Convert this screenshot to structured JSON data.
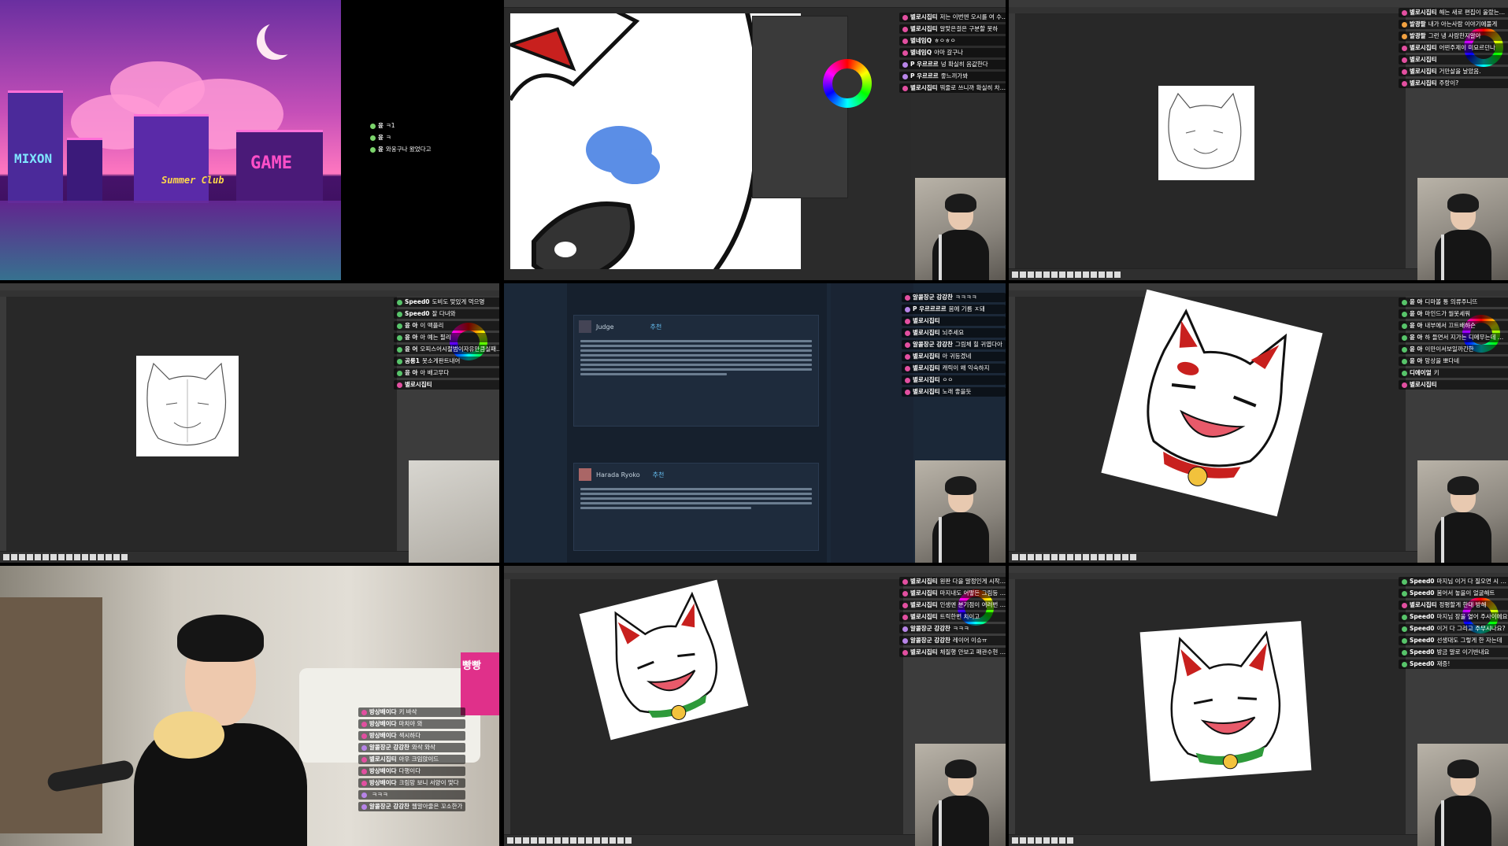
{
  "cells": {
    "c1": {
      "signs": {
        "left": "MIXON",
        "center": "Summer Club",
        "right": "GAME"
      },
      "chat": [
        {
          "nick": "윤",
          "text": "ㅋ1",
          "color": "#7bd36b"
        },
        {
          "nick": "윤",
          "text": "ㅋ",
          "color": "#7bd36b"
        },
        {
          "nick": "윤",
          "text": "와웅구나 왔었다고",
          "color": "#7bd36b"
        }
      ]
    },
    "c2": {
      "chat": [
        {
          "nick": "별로시집티",
          "text": "저는 이번엔 오시를 여 수업에 대해서 알게됐는데",
          "color": "#e24fa0"
        },
        {
          "nick": "별로시집티",
          "text": "알맞은걸은 구분할 못하",
          "color": "#e24fa0"
        },
        {
          "nick": "별네임Q",
          "text": "ㅎㅇㅎㅇ",
          "color": "#e24fa0"
        },
        {
          "nick": "별네임Q",
          "text": "아마 갈구나",
          "color": "#e24fa0"
        },
        {
          "nick": "P 우르르르",
          "text": "넝 확실히 음값한다",
          "color": "#b784e8"
        },
        {
          "nick": "P 우르르르",
          "text": "좋느끼가봐",
          "color": "#b784e8"
        },
        {
          "nick": "별로시집티",
          "text": "뭐줄로 쓰니까 확실히 차이를 느끼겠음",
          "color": "#e24fa0"
        }
      ]
    },
    "c3": {
      "chat": [
        {
          "nick": "별로시집티",
          "text": "해는 새로 편집이 울랐는데, 기존 우로겠다",
          "color": "#e24fa0"
        },
        {
          "nick": "발광팔",
          "text": "내가 아는사람 이야기에풀게",
          "color": "#f0a040"
        },
        {
          "nick": "발광팔",
          "text": "그런 냉 사람한지알아",
          "color": "#f0a040"
        },
        {
          "nick": "별로시집티",
          "text": "어떤주제이 미묘르던나",
          "color": "#e24fa0"
        },
        {
          "nick": "별로시집티",
          "text": "",
          "color": "#e24fa0"
        },
        {
          "nick": "별로시집티",
          "text": "거만살을 날았음.",
          "color": "#e24fa0"
        },
        {
          "nick": "별로시집티",
          "text": "주랑이?",
          "color": "#e24fa0"
        }
      ]
    },
    "c4": {
      "chat": [
        {
          "nick": "Speed0",
          "text": "도비도 맞있게 먹으명",
          "color": "#57c46a"
        },
        {
          "nick": "Speed0",
          "text": "잘 다녀와",
          "color": "#57c46a"
        },
        {
          "nick": "윤 아",
          "text": "이 맥플리",
          "color": "#57c46a"
        },
        {
          "nick": "윤 아",
          "text": "아 예는 필리",
          "color": "#57c46a"
        },
        {
          "nick": "윤 어",
          "text": "오피스어시절범이자유만큼실패뛰어요",
          "color": "#57c46a"
        },
        {
          "nick": "공룡1",
          "text": "못소게판트내어",
          "color": "#57c46a"
        },
        {
          "nick": "윤 아",
          "text": "아 배고무다",
          "color": "#57c46a"
        },
        {
          "nick": "별로시집티",
          "text": "",
          "color": "#e24fa0"
        }
      ]
    },
    "c5": {
      "reviews": [
        {
          "author": "Judge",
          "verdict": "추천"
        },
        {
          "author": "Harada Ryoko",
          "verdict": "추천"
        }
      ],
      "chat": [
        {
          "nick": "알콜장군 강강찬",
          "text": "ㅋㅋㅋㅋ",
          "color": "#e24fa0"
        },
        {
          "nick": "P 우르르르르",
          "text": "몸에 기름 ㅈ돼",
          "color": "#b784e8"
        },
        {
          "nick": "별로시집티",
          "text": "",
          "color": "#e24fa0"
        },
        {
          "nick": "별로시집티",
          "text": "뇌주세요",
          "color": "#e24fa0"
        },
        {
          "nick": "알콜장군 강강찬",
          "text": "그림체 힐 귀엽다아",
          "color": "#e24fa0"
        },
        {
          "nick": "별로시집티",
          "text": "아 귀등겠네",
          "color": "#e24fa0"
        },
        {
          "nick": "별로시집티",
          "text": "캐릭이 왜 익숙하지",
          "color": "#e24fa0"
        },
        {
          "nick": "별로시집티",
          "text": "ㅇㅇ",
          "color": "#e24fa0"
        },
        {
          "nick": "별로시집티",
          "text": "노래 좋을듯",
          "color": "#e24fa0"
        }
      ]
    },
    "c6": {
      "chat": [
        {
          "nick": "윤 아",
          "text": "디마볼 통 의류주니뜨",
          "color": "#57c46a"
        },
        {
          "nick": "윤 아",
          "text": "마인드가 월못세워",
          "color": "#57c46a"
        },
        {
          "nick": "윤 아",
          "text": "내부에서 끄트배하슨",
          "color": "#57c46a"
        },
        {
          "nick": "윤 아",
          "text": "하 들면서 지가는 디메무는데 뭐 문이었던데",
          "color": "#57c46a"
        },
        {
          "nick": "윤 아",
          "text": "이만이서보일까긴한",
          "color": "#57c46a"
        },
        {
          "nick": "윤 아",
          "text": "망상을 뽀다네",
          "color": "#57c46a"
        },
        {
          "nick": "디에이얼",
          "text": "키",
          "color": "#57c46a"
        },
        {
          "nick": "별로시집티",
          "text": "",
          "color": "#e24fa0"
        }
      ]
    },
    "c7": {
      "chat": [
        {
          "nick": "방상배이다",
          "text": "키 바삭",
          "color": "#e24fa0"
        },
        {
          "nick": "방상배이다",
          "text": "마치야 와",
          "color": "#e24fa0"
        },
        {
          "nick": "방상배이다",
          "text": "섹시하다",
          "color": "#e24fa0"
        },
        {
          "nick": "알콜장군 강강찬",
          "text": "와삭 와삭",
          "color": "#b784e8"
        },
        {
          "nick": "별로시집티",
          "text": "아우 크임앉이드",
          "color": "#e24fa0"
        },
        {
          "nick": "방상배이다",
          "text": "다행이다",
          "color": "#e24fa0"
        },
        {
          "nick": "방상배이다",
          "text": "크림망 보니 서양이 맞다",
          "color": "#e24fa0"
        },
        {
          "nick": "",
          "text": "ㅋㅋㅋ",
          "color": "#b784e8"
        },
        {
          "nick": "알콜장군 강강찬",
          "text": "웹말아줄은 꼬소한가",
          "color": "#b784e8"
        }
      ],
      "box_text": "빵빵"
    },
    "c8": {
      "chat": [
        {
          "nick": "별로시집티",
          "text": "원판 다을 말정인게 시작하는거야",
          "color": "#e24fa0"
        },
        {
          "nick": "별로시집티",
          "text": "마지내도 어떻든 그림등 놀고있던 알느니, 생장중이요",
          "color": "#e24fa0"
        },
        {
          "nick": "별로시집티",
          "text": "인생엔 분기점이 여러번 온다고",
          "color": "#e24fa0"
        },
        {
          "nick": "별로시집티",
          "text": "트릭한번 치이고",
          "color": "#e24fa0"
        },
        {
          "nick": "알콜장군 강강찬",
          "text": "ㅋㅋㅋ",
          "color": "#b784e8"
        },
        {
          "nick": "알콜장군 강강찬",
          "text": "레이어 이슈ㅠ",
          "color": "#b784e8"
        },
        {
          "nick": "별로시집티",
          "text": "체질행 안보고 패관수현 잘하요!",
          "color": "#e24fa0"
        }
      ]
    },
    "c9": {
      "chat": [
        {
          "nick": "Speed0",
          "text": "마지님 이거 다 질오면 시 놓을지 날 거 같아요",
          "color": "#57c46a"
        },
        {
          "nick": "Speed0",
          "text": "봄어서 놓을이 얼굴해트",
          "color": "#57c46a"
        },
        {
          "nick": "별로시집티",
          "text": "정평할게 한대 방해",
          "color": "#e24fa0"
        },
        {
          "nick": "Speed0",
          "text": "마지님 장울 열어 주사이에요",
          "color": "#57c46a"
        },
        {
          "nick": "Speed0",
          "text": "이거 다 그리고 주무시나요?",
          "color": "#57c46a"
        },
        {
          "nick": "Speed0",
          "text": "선생대도 그렇게 한 자는데",
          "color": "#57c46a"
        },
        {
          "nick": "Speed0",
          "text": "방금 말로 이기반내요",
          "color": "#57c46a"
        },
        {
          "nick": "Speed0",
          "text": "재증!",
          "color": "#57c46a"
        }
      ]
    }
  },
  "colors": {
    "accent_pink": "#e24fa0",
    "accent_green": "#57c46a",
    "panel": "#3c3c3c",
    "canvas": "#282828"
  }
}
